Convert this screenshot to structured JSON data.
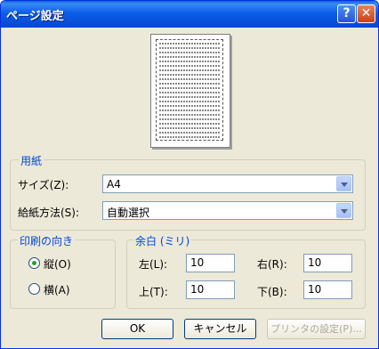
{
  "window": {
    "title": "ページ設定",
    "help_label": "?",
    "close_label": "✕"
  },
  "paper": {
    "group_label": "用紙",
    "size_label": "サイズ(Z):",
    "size_value": "A4",
    "source_label": "給紙方法(S):",
    "source_value": "自動選択"
  },
  "orientation": {
    "group_label": "印刷の向き",
    "portrait_label": "縦(O)",
    "landscape_label": "横(A)",
    "selected": "portrait"
  },
  "margins": {
    "group_label": "余白 (ミリ)",
    "left_label": "左(L):",
    "left_value": "10",
    "right_label": "右(R):",
    "right_value": "10",
    "top_label": "上(T):",
    "top_value": "10",
    "bottom_label": "下(B):",
    "bottom_value": "10"
  },
  "buttons": {
    "ok": "OK",
    "cancel": "キャンセル",
    "printer": "プリンタの設定(P)..."
  },
  "colors": {
    "titlebar": "#0b5ee8",
    "group_label": "#0046d5",
    "dialog_bg": "#ece9d8"
  }
}
